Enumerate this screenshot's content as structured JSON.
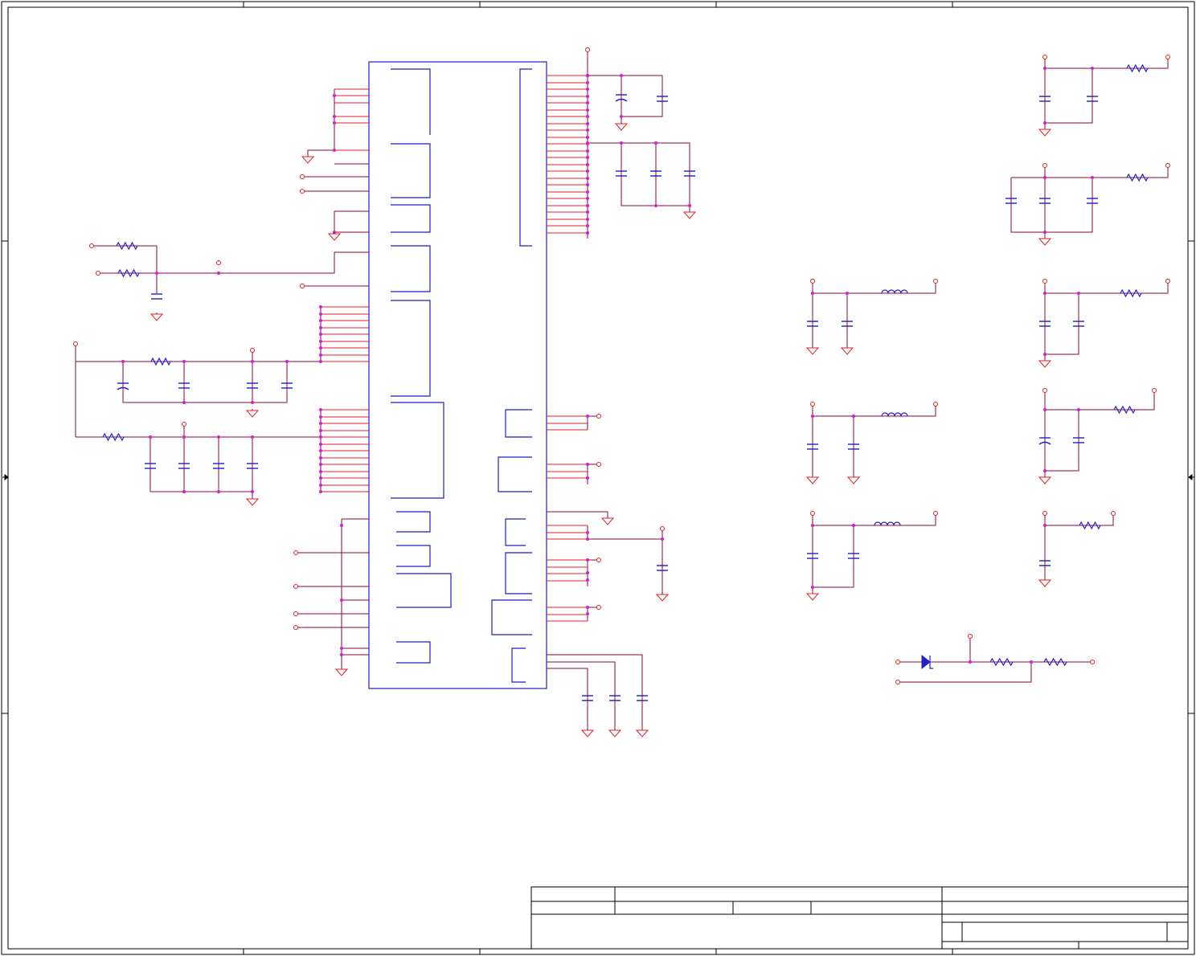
{
  "colors": {
    "wire": "#8b0a3c",
    "pin": "#e0202a",
    "part": "#1f1fc8",
    "junction": "#d61cd6",
    "frame": "#000000",
    "background": "#ffffff"
  },
  "icons": {
    "ground": "ground-icon",
    "junction": "junction-dot-icon",
    "port": "net-port-icon",
    "resistor": "resistor-icon",
    "capacitor": "capacitor-icon",
    "polarized_capacitor": "polarized-capacitor-icon",
    "inductor": "inductor-icon",
    "diode": "diode-icon",
    "zone_arrow": "zone-arrow-icon"
  },
  "title_block": {}
}
